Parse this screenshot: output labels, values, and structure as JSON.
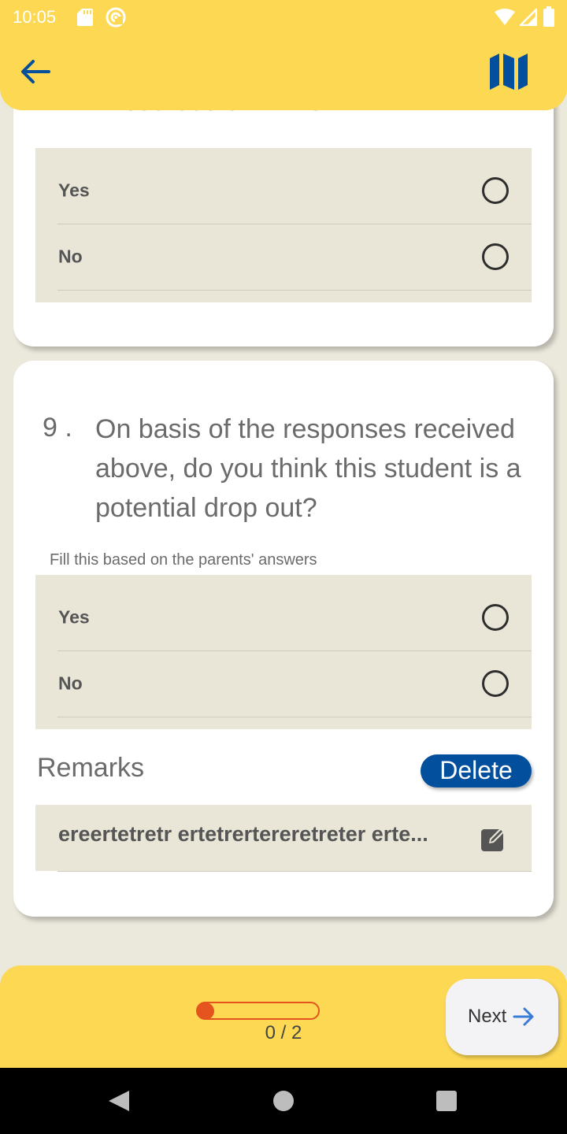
{
  "status_bar": {
    "time": "10:05",
    "icons": [
      "sd-card-icon",
      "sync-icon",
      "wifi-icon",
      "signal-icon",
      "battery-icon"
    ]
  },
  "app_bar": {
    "background": "#fdd853",
    "icons": [
      "back-arrow-icon",
      "map-icon"
    ],
    "accent": "#024f9d"
  },
  "previous_question": {
    "visible_text": "in courses on DIKSHA.",
    "options": [
      {
        "label": "Yes"
      },
      {
        "label": "No"
      }
    ]
  },
  "question": {
    "number": "9 .",
    "text": "On basis of the responses received above, do you think this student is a potential drop out?",
    "hint": "Fill this based on the parents' answers",
    "options": [
      {
        "label": "Yes"
      },
      {
        "label": "No"
      }
    ],
    "remarks": {
      "label": "Remarks",
      "delete_label": "Delete",
      "value": "ereertetretr ertetrertereretreter erte..."
    }
  },
  "footer": {
    "progress_text": "0 / 2",
    "progress_value": 0,
    "next_label": "Next",
    "progress_color": "#e5531f"
  },
  "nav_bar": {
    "icons": [
      "nav-back-icon",
      "nav-home-icon",
      "nav-recents-icon"
    ]
  }
}
